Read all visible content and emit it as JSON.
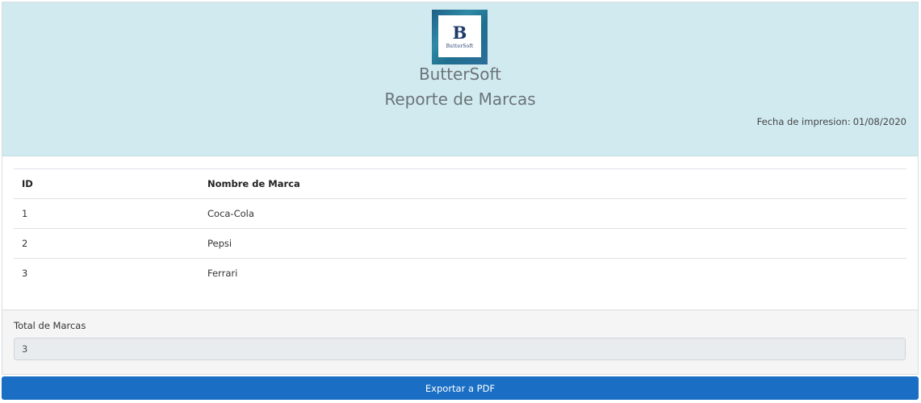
{
  "header": {
    "logo": {
      "letter": "B",
      "text": "ButterSoft"
    },
    "company": "ButterSoft",
    "title": "Reporte de Marcas",
    "print_date_label": "Fecha de impresion:",
    "print_date_value": "01/08/2020"
  },
  "table": {
    "columns": [
      "ID",
      "Nombre de Marca"
    ],
    "rows": [
      {
        "id": "1",
        "name": "Coca-Cola"
      },
      {
        "id": "2",
        "name": "Pepsi"
      },
      {
        "id": "3",
        "name": "Ferrari"
      }
    ]
  },
  "footer": {
    "total_label": "Total de Marcas",
    "total_value": "3"
  },
  "export_button": "Exportar a PDF",
  "colors": {
    "header_bg": "#d1eaf0",
    "button_bg": "#1a6fc4",
    "footer_bg": "#f5f5f5"
  }
}
